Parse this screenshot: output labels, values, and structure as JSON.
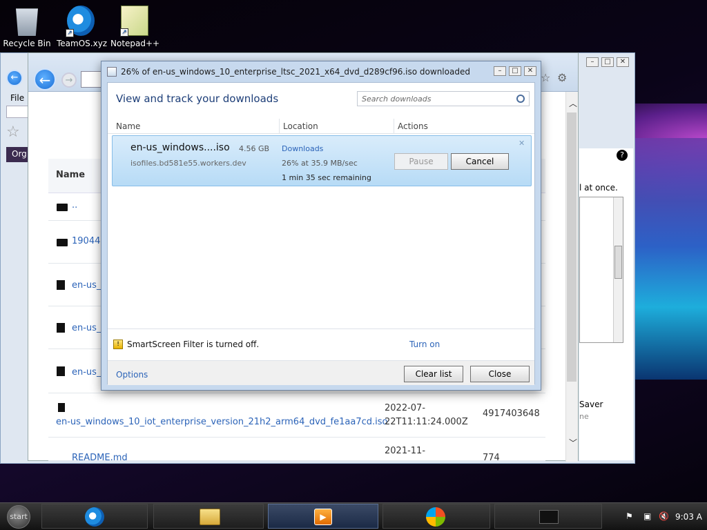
{
  "desktop": {
    "icons": [
      {
        "label": "Recycle Bin",
        "icon": "recycle-bin-icon"
      },
      {
        "label": "TeamOS.xyz",
        "icon": "internet-explorer-icon"
      },
      {
        "label": "Notepad++",
        "icon": "notepad-plus-plus-icon"
      }
    ]
  },
  "browser": {
    "menu_file": "File",
    "org_label": "Org",
    "table_header_name": "Name",
    "rows": [
      {
        "name": ".."
      },
      {
        "name": "19044"
      },
      {
        "name": "en-us_v"
      },
      {
        "name": "en-us_v"
      },
      {
        "name": "en-us_v"
      },
      {
        "name": "en-us_windows_10_iot_enterprise_version_21h2_arm64_dvd_fe1aa7cd.iso",
        "date": "2022-07-22T11:11:24.000Z",
        "size": "4917403648"
      },
      {
        "name": "README.md",
        "date": "2021-11-",
        "size": "774"
      }
    ],
    "side_text": "l at once.",
    "saver_label": "Saver",
    "saver_sub": "ne"
  },
  "download_manager": {
    "title": "26% of en-us_windows_10_enterprise_ltsc_2021_x64_dvd_d289cf96.iso downloaded",
    "heading": "View and track your downloads",
    "search_placeholder": "Search downloads",
    "columns": {
      "name": "Name",
      "location": "Location",
      "actions": "Actions"
    },
    "item": {
      "filename": "en-us_windows....iso",
      "size": "4.56 GB",
      "source": "isofiles.bd581e55.workers.dev",
      "location": "Downloads",
      "progress_text": "26% at 35.9 MB/sec",
      "remaining": "1 min 35 sec remaining",
      "pause_label": "Pause",
      "cancel_label": "Cancel"
    },
    "smartscreen_text": "SmartScreen Filter is turned off.",
    "turn_on_label": "Turn on",
    "options_label": "Options",
    "clear_list_label": "Clear list",
    "close_label": "Close"
  },
  "taskbar": {
    "start_label": "start",
    "clock": "9:03 A"
  }
}
